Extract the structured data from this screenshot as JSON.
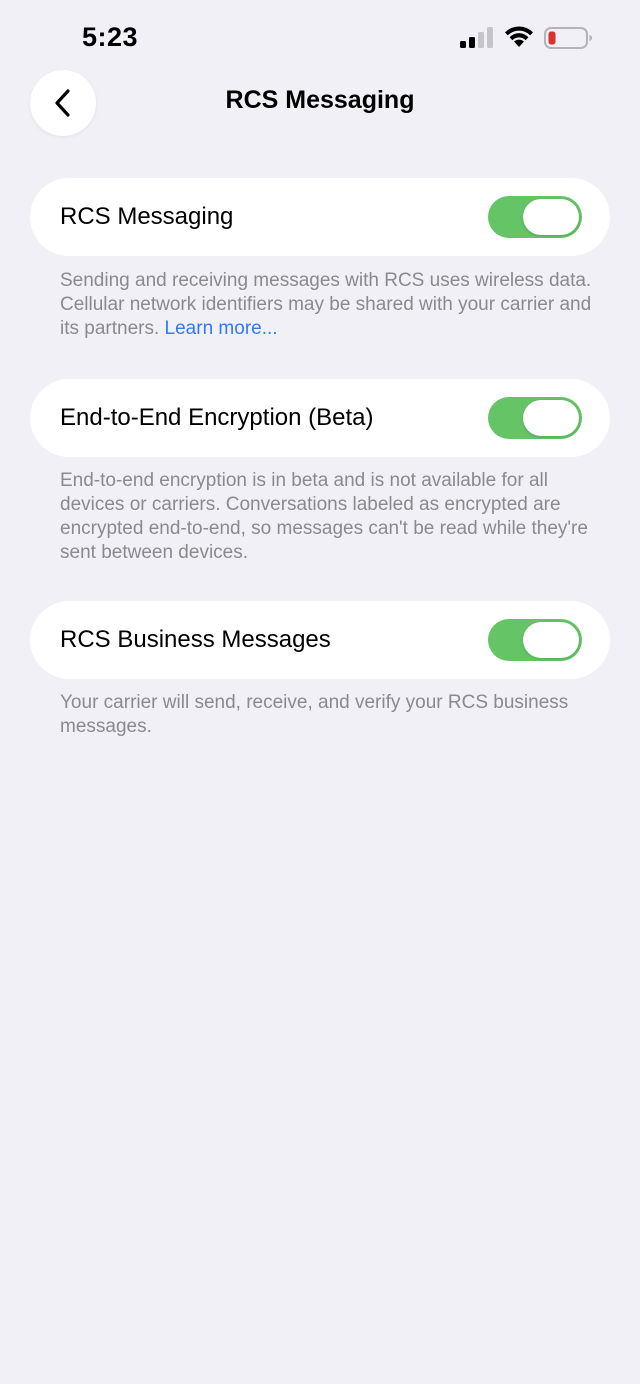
{
  "status_bar": {
    "time": "5:23",
    "signal_icon": "cellular-signal-icon",
    "wifi_icon": "wifi-icon",
    "battery_icon": "battery-low-icon",
    "battery_color": "#e0322d"
  },
  "nav": {
    "back_icon": "chevron-left-icon",
    "title": "RCS Messaging"
  },
  "settings": [
    {
      "label": "RCS Messaging",
      "enabled": true,
      "footnote": "Sending and receiving messages with RCS uses wireless data. Cellular network identifiers may be shared with your carrier and its partners.",
      "link": "Learn more..."
    },
    {
      "label": "End-to-End Encryption (Beta)",
      "enabled": true,
      "footnote": "End-to-end encryption is in beta and is not available for all devices or carriers. Conversations labeled as encrypted are encrypted end-to-end, so messages can't be read while they're sent between devices."
    },
    {
      "label": "RCS Business Messages",
      "enabled": true,
      "footnote": "Your carrier will send, receive, and verify your RCS business messages."
    }
  ],
  "colors": {
    "background": "#f0f0f6",
    "toggle_on": "#65c466",
    "link": "#3478f6",
    "footnote_text": "#8a8a8e"
  }
}
